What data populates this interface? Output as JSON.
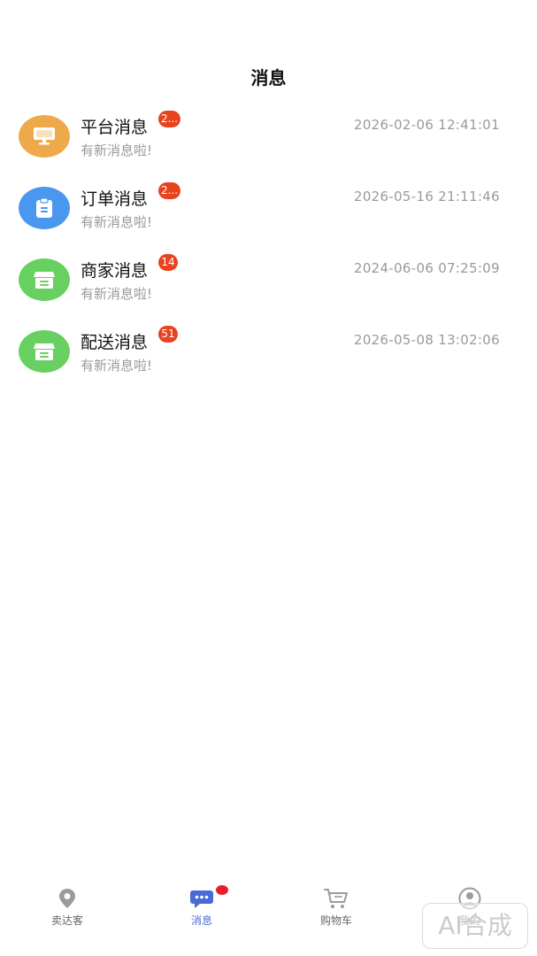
{
  "header": {
    "title": "消息"
  },
  "messages": [
    {
      "title": "平台消息",
      "badge": "2...",
      "subtitle": "有新消息啦!",
      "time": "2026-02-06 12:41:01",
      "icon": "monitor-icon",
      "color": "#eeaa4a"
    },
    {
      "title": "订单消息",
      "badge": "2...",
      "subtitle": "有新消息啦!",
      "time": "2026-05-16 21:11:46",
      "icon": "clipboard-icon",
      "color": "#4a97f0"
    },
    {
      "title": "商家消息",
      "badge": "14",
      "subtitle": "有新消息啦!",
      "time": "2024-06-06 07:25:09",
      "icon": "store-icon",
      "color": "#68d060"
    },
    {
      "title": "配送消息",
      "badge": "51",
      "subtitle": "有新消息啦!",
      "time": "2026-05-08 13:02:06",
      "icon": "store-icon",
      "color": "#68d060"
    }
  ],
  "tabbar": {
    "items": [
      {
        "label": "卖达客",
        "icon": "location-pin-icon"
      },
      {
        "label": "消息",
        "icon": "chat-bubble-icon",
        "active": true
      },
      {
        "label": "购物车",
        "icon": "cart-icon"
      },
      {
        "label": "我的",
        "icon": "user-icon"
      }
    ],
    "accent": "#4a6bd6",
    "dot_color": "#e8202a"
  },
  "watermark": "AI合成"
}
